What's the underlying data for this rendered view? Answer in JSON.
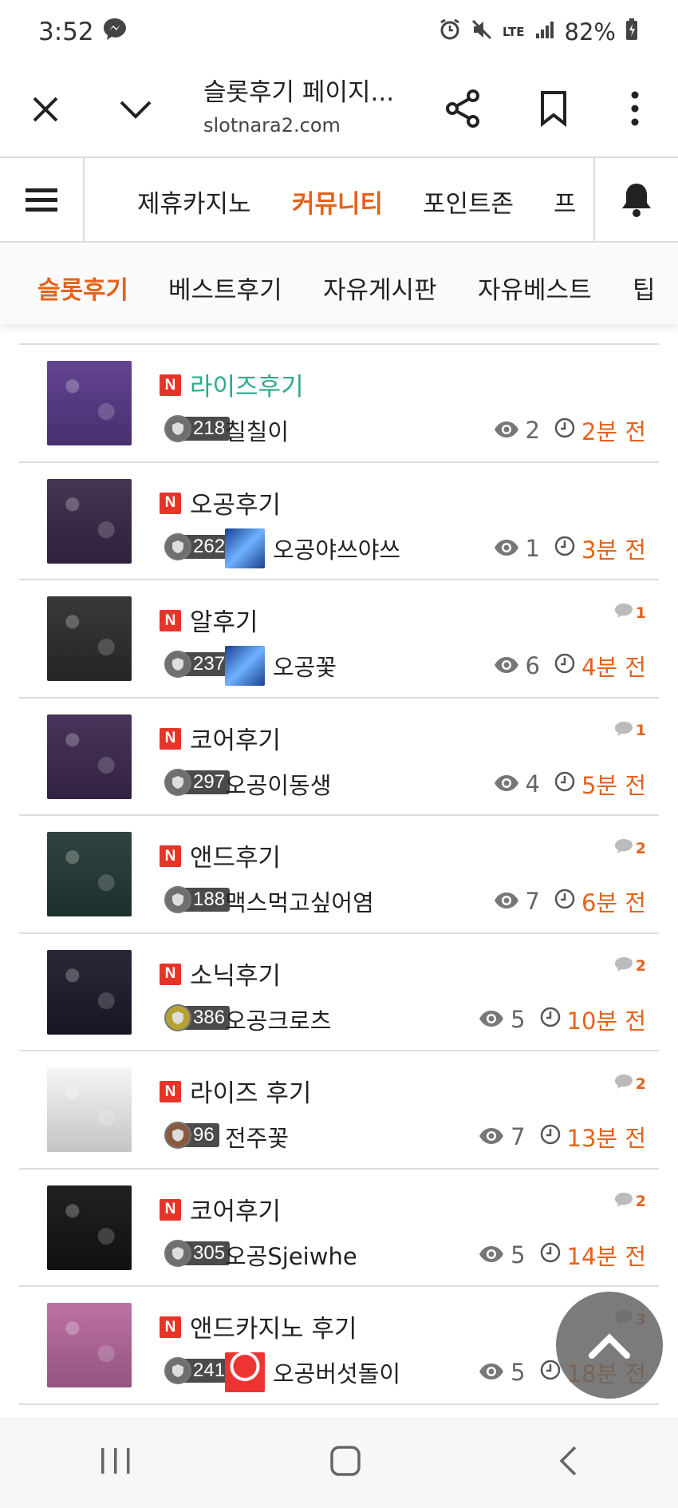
{
  "status": {
    "time": "3:52",
    "network": "LTE",
    "battery": "82%"
  },
  "browser": {
    "title": "슬롯후기 페이지...",
    "url": "slotnara2.com"
  },
  "nav_main": {
    "items": [
      {
        "label": "제휴카지노",
        "active": false
      },
      {
        "label": "커뮤니티",
        "active": true
      },
      {
        "label": "포인트존",
        "active": false
      },
      {
        "label": "프",
        "active": false
      }
    ]
  },
  "nav_sub": {
    "items": [
      {
        "label": "슬롯후기",
        "active": true
      },
      {
        "label": "베스트후기",
        "active": false
      },
      {
        "label": "자유게시판",
        "active": false
      },
      {
        "label": "자유베스트",
        "active": false
      },
      {
        "label": "팁",
        "active": false
      }
    ]
  },
  "posts": [
    {
      "title": "라이즈후기",
      "level": "218",
      "author": "칠칠이",
      "views": "2",
      "time": "2분 전",
      "comments": "",
      "avatar": false,
      "highlight": true,
      "thumb_color": "#5a3a8a"
    },
    {
      "title": "오공후기",
      "level": "262",
      "author": "오공야쓰야쓰",
      "views": "1",
      "time": "3분 전",
      "comments": "",
      "avatar": true,
      "highlight": false,
      "thumb_color": "#3a2a4a"
    },
    {
      "title": "알후기",
      "level": "237",
      "author": "오공꽃",
      "views": "6",
      "time": "4분 전",
      "comments": "1",
      "avatar": true,
      "highlight": false,
      "thumb_color": "#2e2e2e"
    },
    {
      "title": "코어후기",
      "level": "297",
      "author": "오공이동생",
      "views": "4",
      "time": "5분 전",
      "comments": "1",
      "avatar": false,
      "highlight": false,
      "thumb_color": "#3e2a52"
    },
    {
      "title": "앤드후기",
      "level": "188",
      "author": "맥스먹고싶어염",
      "views": "7",
      "time": "6분 전",
      "comments": "2",
      "avatar": false,
      "highlight": false,
      "thumb_color": "#243a36"
    },
    {
      "title": "소닉후기",
      "level": "386",
      "author": "오공크로츠",
      "views": "5",
      "time": "10분 전",
      "comments": "2",
      "avatar": false,
      "highlight": false,
      "thumb_color": "#1c1c2c"
    },
    {
      "title": "라이즈 후기",
      "level": "96",
      "author": "전주꽃",
      "views": "7",
      "time": "13분 전",
      "comments": "2",
      "avatar": false,
      "highlight": false,
      "thumb_color": "#f5f5f5"
    },
    {
      "title": "코어후기",
      "level": "305",
      "author": "오공Sjeiwhe",
      "views": "5",
      "time": "14분 전",
      "comments": "2",
      "avatar": false,
      "highlight": false,
      "thumb_color": "#151515"
    },
    {
      "title": "앤드카지노 후기",
      "level": "241",
      "author": "오공버섯돌이",
      "views": "5",
      "time": "18분 전",
      "comments": "3",
      "avatar": true,
      "highlight": false,
      "thumb_color": "#b86aa0"
    }
  ]
}
